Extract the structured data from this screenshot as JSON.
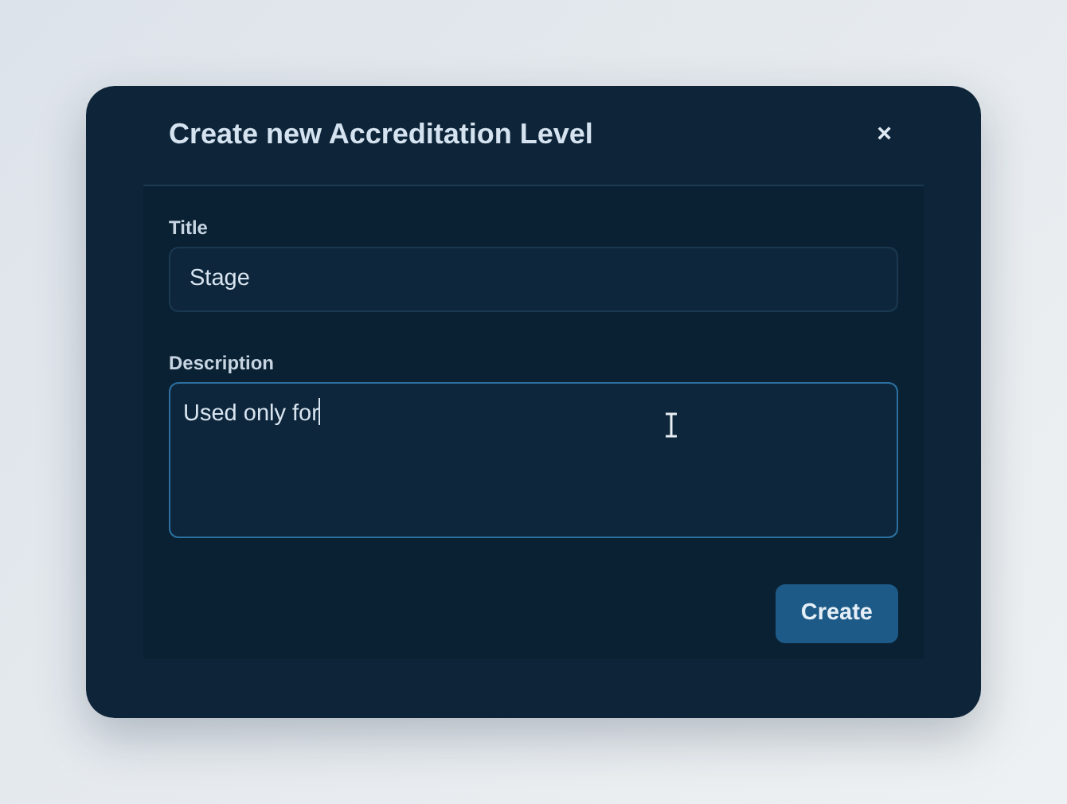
{
  "dialog": {
    "title": "Create new Accreditation Level",
    "close": "×"
  },
  "fields": [
    {
      "kind": "input",
      "label": "Title",
      "value": "Stage",
      "focused": false
    },
    {
      "kind": "textarea",
      "label": "Description",
      "value": "Used only for",
      "focused": true
    }
  ],
  "buttons": [
    {
      "label": "Create"
    }
  ]
}
